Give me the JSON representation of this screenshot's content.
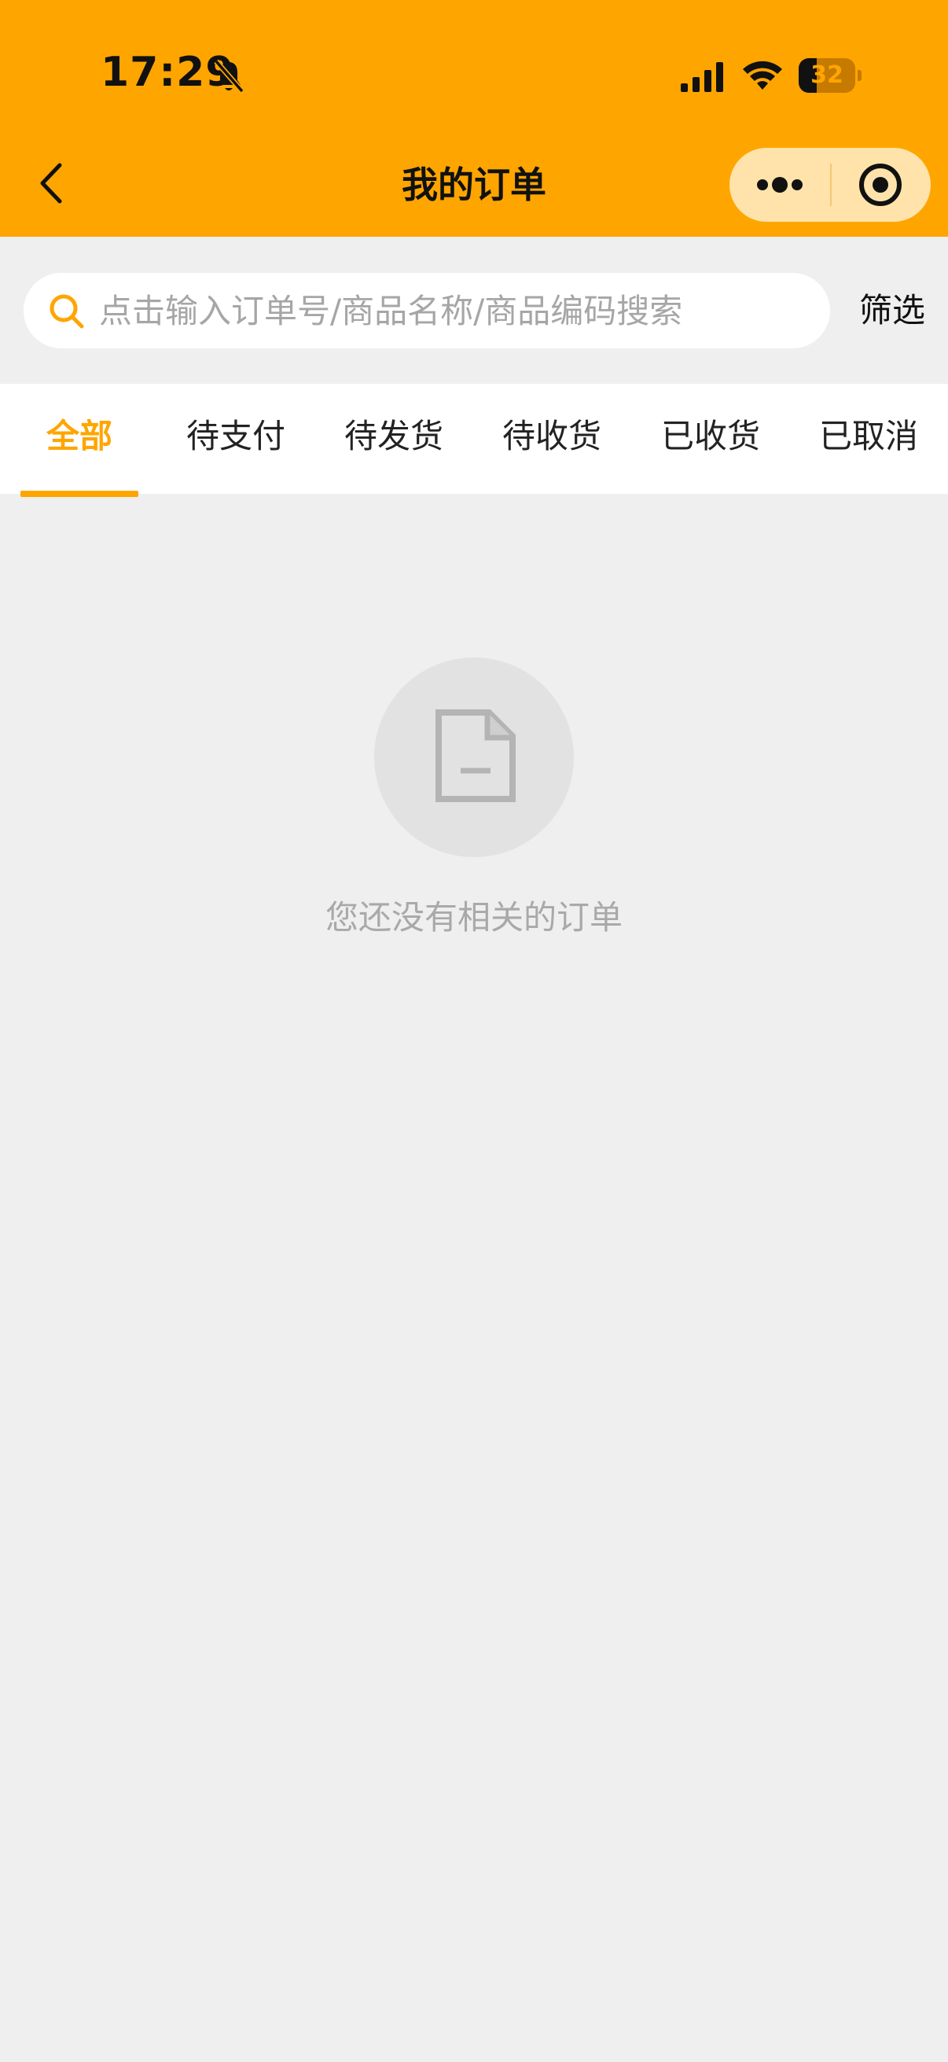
{
  "status_bar": {
    "time": "17:29",
    "battery_level": "32",
    "battery_fraction": 0.32,
    "icons": [
      "bell-muted-icon",
      "signal-icon",
      "wifi-icon",
      "battery-icon"
    ]
  },
  "nav": {
    "title": "我的订单",
    "back_icon": "chevron-left-icon",
    "capsule_icons": [
      "more-dots-icon",
      "target-circle-icon"
    ]
  },
  "search": {
    "placeholder": "点击输入订单号/商品名称/商品编码搜索",
    "value": "",
    "filter_label": "筛选"
  },
  "tabs": [
    {
      "label": "全部",
      "active": true
    },
    {
      "label": "待支付",
      "active": false
    },
    {
      "label": "待发货",
      "active": false
    },
    {
      "label": "待收货",
      "active": false
    },
    {
      "label": "已收货",
      "active": false
    },
    {
      "label": "已取消",
      "active": false
    }
  ],
  "empty_state": {
    "icon": "document-icon",
    "message": "您还没有相关的订单"
  },
  "colors": {
    "brand": "#ffa500",
    "capsule": "#ffe3aa",
    "background": "#efefef",
    "muted_text": "#a9a9a9"
  }
}
